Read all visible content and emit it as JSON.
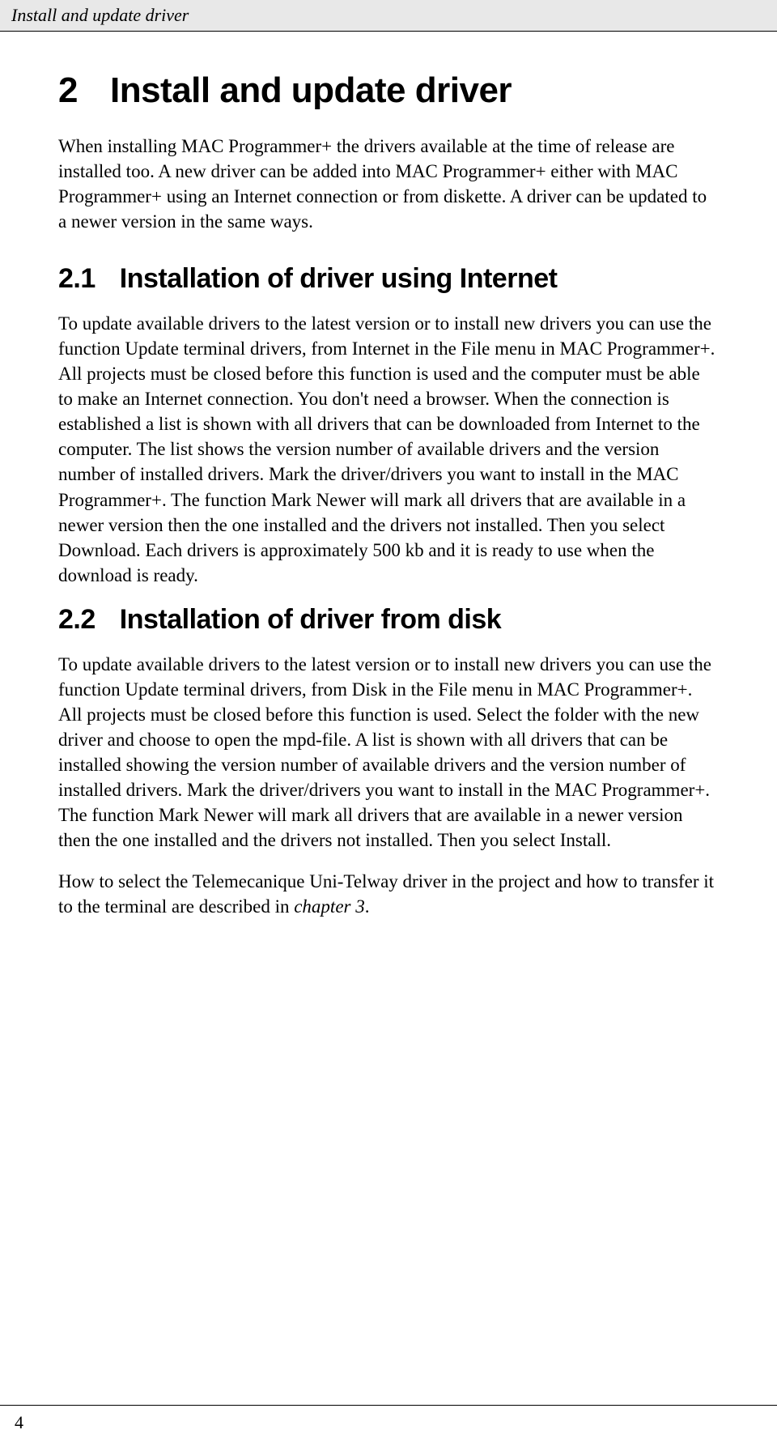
{
  "header": {
    "running_title": "Install and update driver"
  },
  "section": {
    "number": "2",
    "title": "Install and update driver",
    "intro": "When installing MAC Programmer+ the drivers available at the time of release are installed too. A new driver can be added into MAC Programmer+ either with MAC Programmer+ using an Internet connection or from diskette. A driver can be updated to a newer version in the same ways."
  },
  "subsection1": {
    "number": "2.1",
    "title": "Installation of driver using Internet",
    "body": "To update available drivers to the latest version or to install new drivers you can use the function Update terminal drivers, from Internet in the File menu in MAC Programmer+. All projects must be closed before this function is used and the computer must be able to make an Internet connection. You don't need a browser. When the connection is established a list is shown with all drivers that can be downloaded from Internet to the computer. The list shows the version number of available drivers and the version number of installed drivers. Mark the driver/drivers you want to install in the MAC Programmer+. The function Mark Newer will mark all drivers that are available in a newer version then the one installed and the drivers not installed. Then you select Download. Each drivers is approximately 500 kb and it is ready to use when the download is ready."
  },
  "subsection2": {
    "number": "2.2",
    "title": "Installation of driver from disk",
    "body1": "To update available drivers to the latest version or to install new drivers you can use the function Update terminal drivers, from Disk in the File menu in MAC Programmer+. All projects must be closed before this function is used. Select the folder with the new driver and choose to open the mpd-file. A list is shown with all drivers that can be installed showing the version number of available drivers and the version number of installed drivers. Mark the driver/drivers you want to install in the MAC Programmer+. The function Mark Newer will mark all drivers that are available in a newer version then the one installed and the drivers not installed. Then you select Install.",
    "body2_pre": "How to select the Telemecanique Uni-Telway driver in the project and how to transfer it to the terminal are described in ",
    "body2_ref": "chapter 3",
    "body2_post": "."
  },
  "footer": {
    "page_number": "4"
  }
}
